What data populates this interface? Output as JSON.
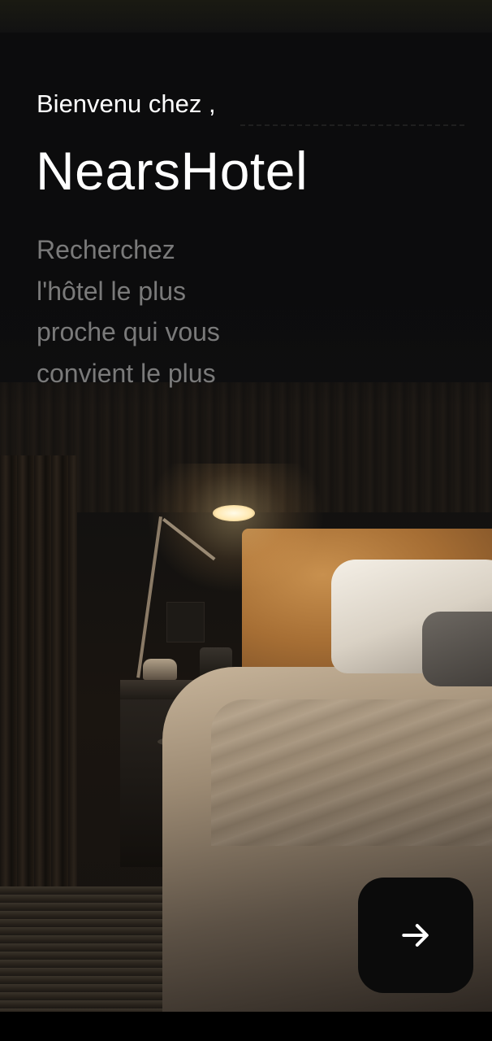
{
  "welcome": {
    "greeting": "Bienvenu chez ,",
    "app_name": "NearsHotel",
    "tagline_lines": [
      "Recherchez",
      "l'hôtel le plus",
      "proche qui vous",
      "convient le plus"
    ]
  },
  "next_button": {
    "icon": "arrow-right-icon"
  },
  "colors": {
    "background": "#0c0c0d",
    "title_text": "#ffffff",
    "tagline_text": "#7a7a7a",
    "button_bg": "#0b0b0b"
  }
}
